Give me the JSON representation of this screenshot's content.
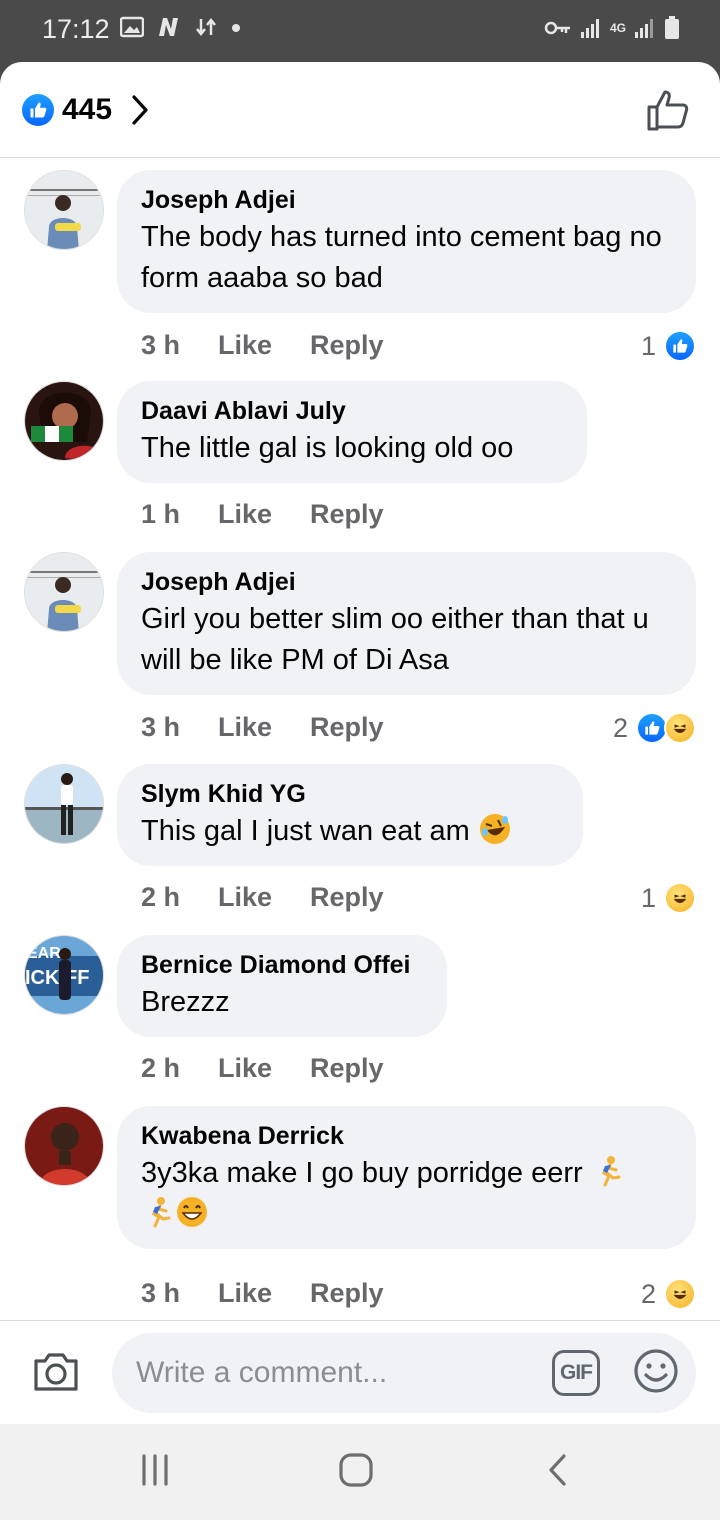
{
  "status_bar": {
    "time": "17:12",
    "network_label": "4G",
    "icons_left": [
      "gallery-icon",
      "n-app-icon",
      "data-transfer-icon",
      "dot-icon"
    ],
    "icons_right": [
      "key-icon",
      "signal-icon",
      "4g-signal-icon",
      "battery-icon"
    ]
  },
  "header": {
    "reaction_count": "445"
  },
  "comments": [
    {
      "author": "Joseph Adjei",
      "text": "The body has turned into cement bag no form aaaba so bad",
      "time": "3 h",
      "like_label": "Like",
      "reply_label": "Reply",
      "reaction_count": "1",
      "reactions": [
        "like"
      ]
    },
    {
      "author": "Daavi Ablavi July",
      "text": "The little gal is looking old oo",
      "time": "1 h",
      "like_label": "Like",
      "reply_label": "Reply",
      "reaction_count": "",
      "reactions": []
    },
    {
      "author": "Joseph Adjei",
      "text": "Girl you better slim oo either than that u will be like PM of Di Asa",
      "time": "3 h",
      "like_label": "Like",
      "reply_label": "Reply",
      "reaction_count": "2",
      "reactions": [
        "like",
        "haha"
      ]
    },
    {
      "author": "Slym Khid YG",
      "text": "This gal I just wan eat am",
      "text_emoji": [
        "rolling-laughing-emoji"
      ],
      "time": "2 h",
      "like_label": "Like",
      "reply_label": "Reply",
      "reaction_count": "1",
      "reactions": [
        "haha"
      ]
    },
    {
      "author": "Bernice Diamond Offei",
      "text": "Brezzz",
      "time": "2 h",
      "like_label": "Like",
      "reply_label": "Reply",
      "reaction_count": "",
      "reactions": []
    },
    {
      "author": "Kwabena Derrick",
      "text": "3y3ka make I go buy porridge eerr",
      "text_emoji": [
        "running-man-emoji",
        "running-man-emoji",
        "grinning-emoji"
      ],
      "time": "3 h",
      "like_label": "Like",
      "reply_label": "Reply",
      "reaction_count": "2",
      "reactions": [
        "haha"
      ]
    }
  ],
  "composer": {
    "placeholder": "Write a comment...",
    "gif_label": "GIF"
  },
  "colors": {
    "like_blue": "#0866ff",
    "bubble_bg": "#f0f2f5",
    "meta_gray": "#65676b",
    "haha_yellow": "#f7b125"
  }
}
